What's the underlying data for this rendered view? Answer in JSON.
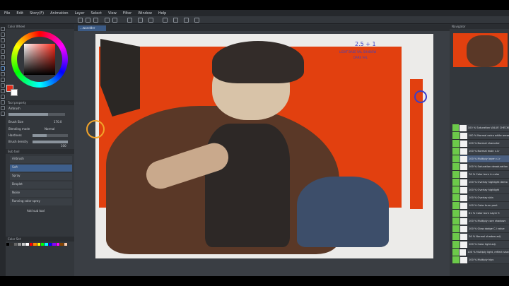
{
  "menu": {
    "items": [
      "File",
      "Edit",
      "Story(F)",
      "Animation",
      "Layer",
      "Select",
      "View",
      "Filter",
      "Window",
      "Help"
    ]
  },
  "canvas": {
    "tab_label": "…wandder"
  },
  "color_panel": {
    "title": "Color Wheel",
    "main_color": "#e02a18",
    "sub_color": "#ffffff"
  },
  "tool_property": {
    "title": "Tool property",
    "tool_name": "Airbrush",
    "brush_size_label": "Brush Size",
    "brush_size_value": "170.0",
    "blending_label": "Blending mode",
    "blending_value": "Normal",
    "hardness_label": "Hardness",
    "density_label": "Brush density",
    "density_value": 100
  },
  "sub_tool": {
    "title": "Sub tool",
    "group": "Airbrush",
    "items": [
      "Soft",
      "Spray",
      "Droplet",
      "Noise",
      "Running color spray"
    ],
    "add_label": "Add sub tool"
  },
  "color_set": {
    "title": "Color Set",
    "colors": [
      "#000000",
      "#333333",
      "#666666",
      "#999999",
      "#cccccc",
      "#ffffff",
      "#ff0000",
      "#ff8800",
      "#ffff00",
      "#00ff00",
      "#00ffff",
      "#0000ff",
      "#8800ff",
      "#ff00ff",
      "#884400",
      "#ffccaa"
    ]
  },
  "annotations": {
    "line1": "2.5 + 1",
    "line2": "LIGHT  BASE  VAL SHADOW",
    "line3": "DARK    VAL",
    "accent_warm": "#e2400f",
    "accent_ink": "#3b42c4"
  },
  "navigator": {
    "title": "Navigator"
  },
  "layers": [
    {
      "name": "100 % Saturation  VALUE CHECKER",
      "selected": false
    },
    {
      "name": "100 % Normal  extra white areas",
      "selected": false
    },
    {
      "name": "100 % Normal  character",
      "selected": false
    },
    {
      "name": "100 % Normal  main c.l.r",
      "selected": false
    },
    {
      "name": "100 % Multiply  layer c.l.r",
      "selected": true
    },
    {
      "name": "100 % Saturation  desaturation",
      "selected": false
    },
    {
      "name": "76 % Color burn  in color",
      "selected": false
    },
    {
      "name": "100 % Overlay  highlight demo",
      "selected": false
    },
    {
      "name": "100 % Overlay  highlight",
      "selected": false
    },
    {
      "name": "100 % Overlay  skin",
      "selected": false
    },
    {
      "name": "100 % Color burn  pout",
      "selected": false
    },
    {
      "name": "81 % Color burn  Layer 5",
      "selected": false
    },
    {
      "name": "100 % Multiply  core shadows",
      "selected": false
    },
    {
      "name": "100 % Glow dodge  C.l value",
      "selected": false
    },
    {
      "name": "26 % Normal  shadow adj.",
      "selected": false
    },
    {
      "name": "100 % Color  light adj.",
      "selected": false
    },
    {
      "name": "100 % Multiply  light, reflect shadow",
      "selected": false
    },
    {
      "name": "100 % Multiply  hips",
      "selected": false
    }
  ]
}
